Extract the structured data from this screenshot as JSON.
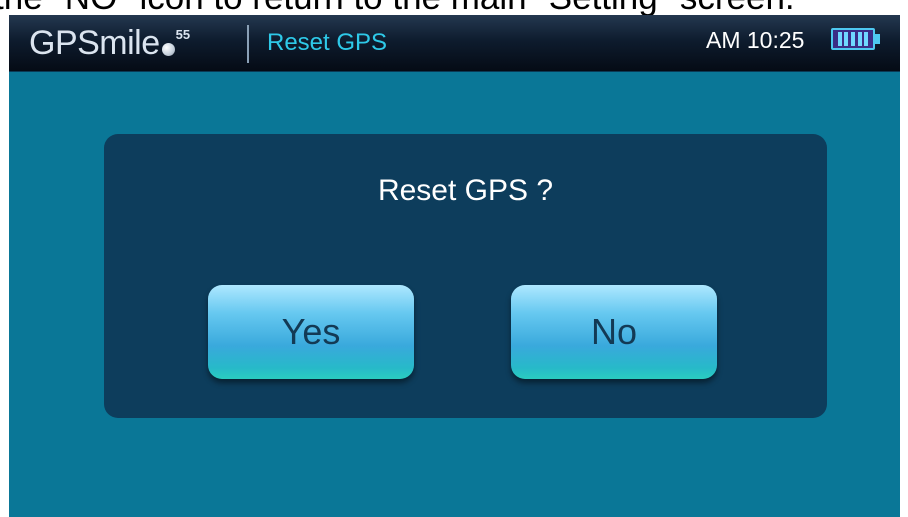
{
  "caption": "the \"NO\" icon to return to the main \"Setting\" screen.",
  "header": {
    "brand": "GPSmile",
    "brand_superscript": "55",
    "screen_title": "Reset GPS",
    "clock": "AM 10:25",
    "battery_icon": "battery-full-icon",
    "battery_level": 1.0
  },
  "dialog": {
    "message": "Reset GPS ?",
    "yes_label": "Yes",
    "no_label": "No"
  },
  "colors": {
    "background": "#0a7797",
    "dialog": "#0d3d5c",
    "title_accent": "#2ec9e8",
    "button": "#39a9dc"
  }
}
